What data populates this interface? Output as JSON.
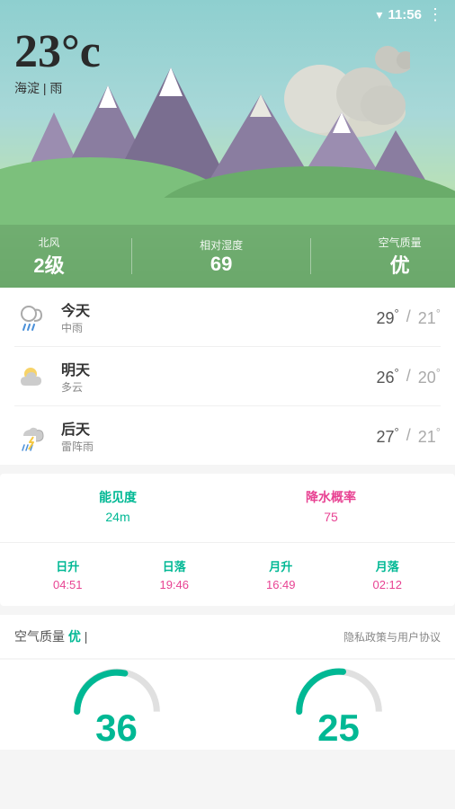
{
  "statusBar": {
    "time": "11:56"
  },
  "weather": {
    "temperature": "23°c",
    "location": "海淀",
    "condition": "雨",
    "wind": {
      "label": "北风",
      "value": "2级"
    },
    "humidity": {
      "label": "相对湿度",
      "value": "69"
    },
    "airQuality": {
      "label": "空气质量",
      "value": "优"
    }
  },
  "forecast": [
    {
      "day": "今天",
      "condition": "中雨",
      "icon": "rain",
      "high": "29",
      "low": "21"
    },
    {
      "day": "明天",
      "condition": "多云",
      "icon": "partly_cloudy",
      "high": "26",
      "low": "20"
    },
    {
      "day": "后天",
      "condition": "雷阵雨",
      "icon": "thunder_rain",
      "high": "27",
      "low": "21"
    }
  ],
  "details": {
    "visibility": {
      "label": "能见度",
      "value": "24m"
    },
    "precipitation": {
      "label": "降水概率",
      "value": "75"
    },
    "sunrise": {
      "label": "日升",
      "value": "04:51"
    },
    "sunset": {
      "label": "日落",
      "value": "19:46"
    },
    "moonrise": {
      "label": "月升",
      "value": "16:49"
    },
    "moonset": {
      "label": "月落",
      "value": "02:12"
    }
  },
  "airQualitySection": {
    "label": "空气质量",
    "badge": "优",
    "separator": "|",
    "links": "隐私政策与用户协议"
  },
  "gauges": {
    "left": "36",
    "right": "25"
  }
}
